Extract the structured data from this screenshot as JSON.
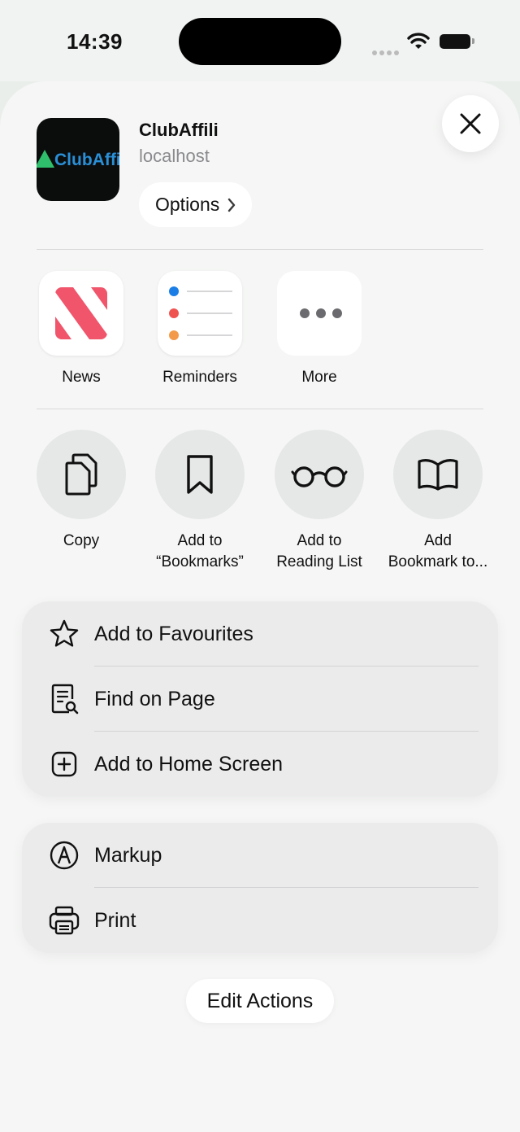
{
  "status_bar": {
    "time": "14:39"
  },
  "header": {
    "app_thumbnail_text": "ClubAffi",
    "title": "ClubAffili",
    "subtitle": "localhost",
    "options_label": "Options"
  },
  "apps": [
    {
      "label": "News",
      "icon": "news-icon"
    },
    {
      "label": "Reminders",
      "icon": "reminders-icon"
    },
    {
      "label": "More",
      "icon": "more-icon"
    }
  ],
  "actions": [
    {
      "label_line1": "Copy",
      "label_line2": "",
      "icon": "copy-icon"
    },
    {
      "label_line1": "Add to",
      "label_line2": "“Bookmarks”",
      "icon": "bookmark-icon"
    },
    {
      "label_line1": "Add to",
      "label_line2": "Reading List",
      "icon": "glasses-icon"
    },
    {
      "label_line1": "Add",
      "label_line2": "Bookmark to...",
      "icon": "book-icon"
    }
  ],
  "group1": [
    {
      "label": "Add to Favourites",
      "icon": "star-icon"
    },
    {
      "label": "Find on Page",
      "icon": "find-on-page-icon"
    },
    {
      "label": "Add to Home Screen",
      "icon": "plus-square-icon"
    }
  ],
  "group2": [
    {
      "label": "Markup",
      "icon": "markup-icon"
    },
    {
      "label": "Print",
      "icon": "printer-icon"
    }
  ],
  "footer": {
    "edit_actions_label": "Edit Actions"
  },
  "colors": {
    "news_red": "#f0556b",
    "reminder_blue": "#1a7ee6",
    "reminder_red": "#ef5350",
    "reminder_orange": "#f39a4a",
    "logo_green": "#2fbf6c",
    "logo_blue": "#2a8fd6"
  }
}
